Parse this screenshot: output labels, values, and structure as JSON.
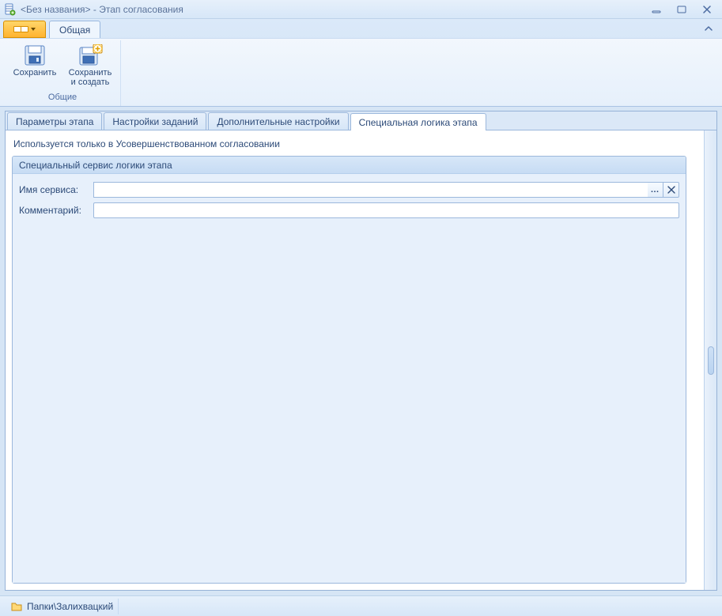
{
  "window": {
    "title": "<Без названия> - Этап согласования"
  },
  "ribbon": {
    "tabs": {
      "general": "Общая"
    },
    "buttons": {
      "save": "Сохранить",
      "save_create_line1": "Сохранить",
      "save_create_line2": "и создать"
    },
    "group_caption": "Общие"
  },
  "main_tabs": {
    "t0": "Параметры этапа",
    "t1": "Настройки заданий",
    "t2": "Дополнительные настройки",
    "t3": "Специальная логика этапа"
  },
  "notice": "Используется только в Усовершенствованном согласовании",
  "groupbox": {
    "title": "Специальный сервис логики этапа",
    "fields": {
      "service_label": "Имя сервиса:",
      "service_value": "",
      "comment_label": "Комментарий:",
      "comment_value": ""
    },
    "buttons": {
      "ellipsis": "…"
    }
  },
  "status": {
    "path": "Папки\\Залихвацкий"
  }
}
